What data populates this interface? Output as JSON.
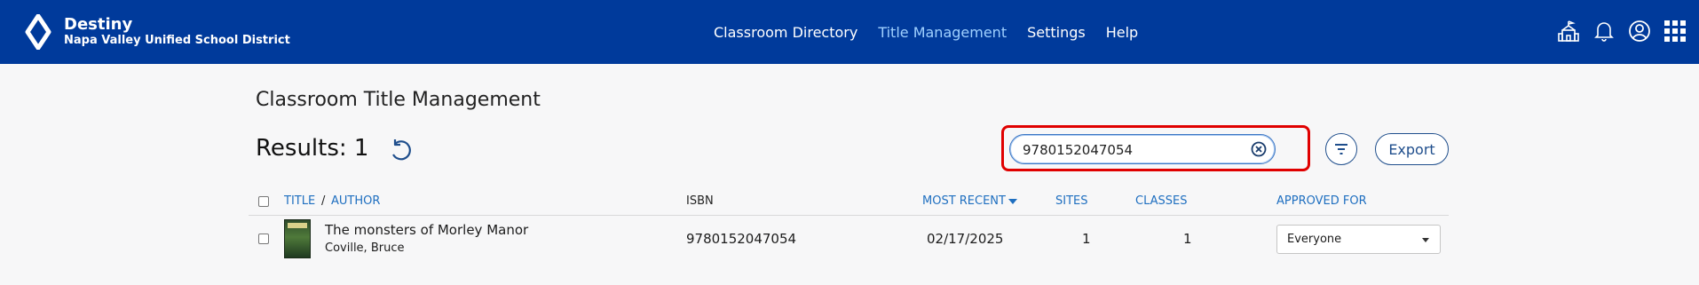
{
  "header": {
    "app_name": "Destiny",
    "district": "Napa Valley Unified School District",
    "nav": [
      {
        "label": "Classroom Directory",
        "active": false
      },
      {
        "label": "Title Management",
        "active": true
      },
      {
        "label": "Settings",
        "active": false
      },
      {
        "label": "Help",
        "active": false
      }
    ],
    "icons": [
      "school-icon",
      "bell-icon",
      "user-icon",
      "app-grid-icon"
    ],
    "colors": {
      "bar": "#003a9b",
      "active_nav": "#9fd0ff"
    }
  },
  "page": {
    "title": "Classroom Title Management",
    "results_label": "Results: 1"
  },
  "search": {
    "value": "9780152047054",
    "placeholder": ""
  },
  "toolbar": {
    "export_label": "Export"
  },
  "table": {
    "headers": {
      "title": "TITLE",
      "separator": "/",
      "author": "AUTHOR",
      "isbn": "ISBN",
      "most_recent": "MOST RECENT",
      "sites": "SITES",
      "classes": "CLASSES",
      "approved_for": "APPROVED FOR"
    },
    "rows": [
      {
        "title": "The monsters of Morley Manor",
        "author": "Coville, Bruce",
        "isbn": "9780152047054",
        "most_recent": "02/17/2025",
        "sites": "1",
        "classes": "1",
        "approved_for": "Everyone"
      }
    ]
  }
}
